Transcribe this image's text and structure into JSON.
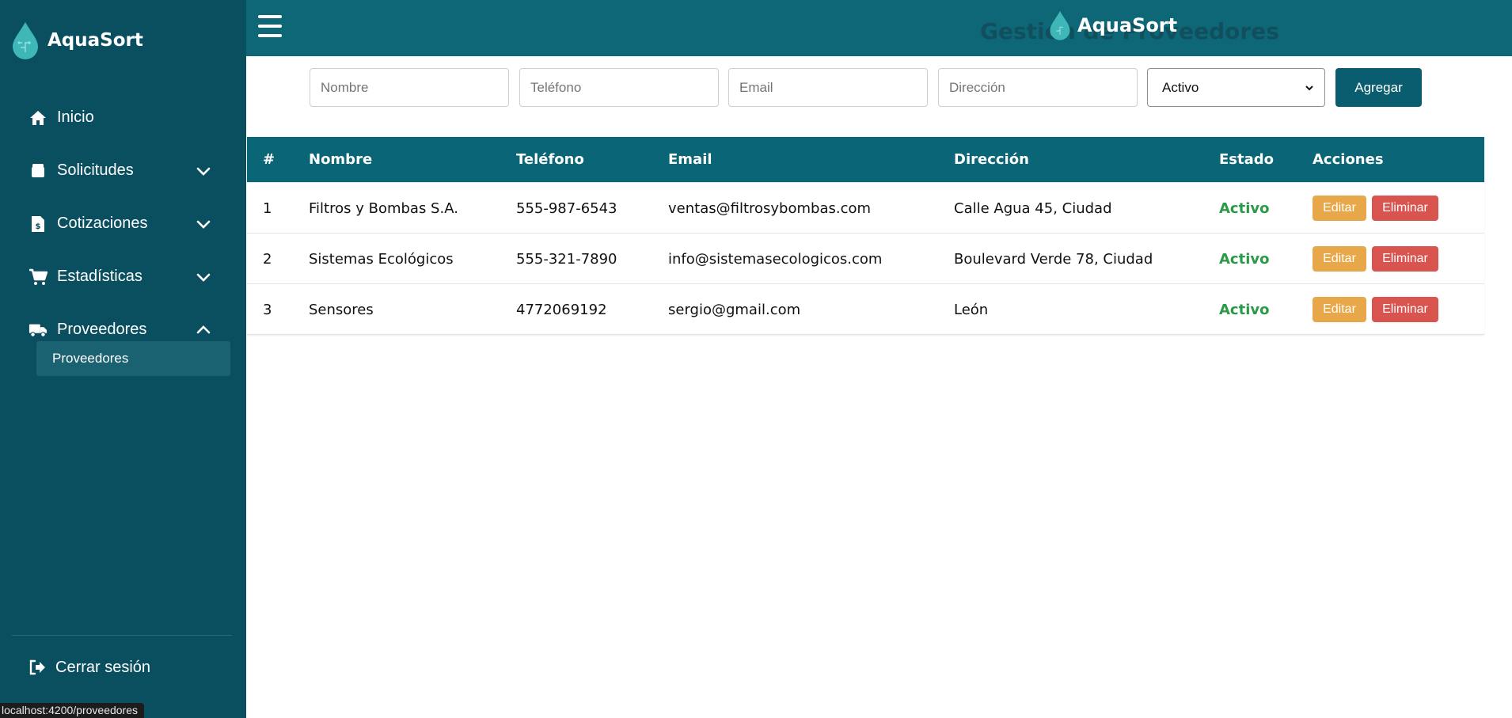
{
  "app": {
    "name": "AquaSort",
    "page_title": "Gestión de Proveedores"
  },
  "colors": {
    "sidebar": "#0a4f60",
    "header": "#0d6777",
    "accent": "#0a5d6e",
    "status_active": "#2a9a48",
    "edit": "#e8a849",
    "delete": "#d9534f"
  },
  "sidebar": {
    "items": [
      {
        "label": "Inicio",
        "icon": "home-icon"
      },
      {
        "label": "Solicitudes",
        "icon": "box-icon"
      },
      {
        "label": "Cotizaciones",
        "icon": "invoice-icon"
      },
      {
        "label": "Estadísticas",
        "icon": "cart-icon"
      },
      {
        "label": "Proveedores",
        "icon": "truck-icon"
      }
    ],
    "subitem": "Proveedores",
    "logout": "Cerrar sesión"
  },
  "status_bar": {
    "url": "localhost:4200/proveedores"
  },
  "form": {
    "nombre_placeholder": "Nombre",
    "telefono_placeholder": "Teléfono",
    "email_placeholder": "Email",
    "direccion_placeholder": "Dirección",
    "estado_value": "Activo",
    "add_label": "Agregar"
  },
  "table": {
    "headers": [
      "#",
      "Nombre",
      "Teléfono",
      "Email",
      "Dirección",
      "Estado",
      "Acciones"
    ],
    "rows": [
      {
        "id": "1",
        "nombre": "Filtros y Bombas S.A.",
        "telefono": "555-987-6543",
        "email": "ventas@filtrosybombas.com",
        "direccion": "Calle Agua 45, Ciudad",
        "estado": "Activo"
      },
      {
        "id": "2",
        "nombre": "Sistemas Ecológicos",
        "telefono": "555-321-7890",
        "email": "info@sistemasecologicos.com",
        "direccion": "Boulevard Verde 78, Ciudad",
        "estado": "Activo"
      },
      {
        "id": "3",
        "nombre": "Sensores",
        "telefono": "4772069192",
        "email": "sergio@gmail.com",
        "direccion": "León",
        "estado": "Activo"
      }
    ],
    "edit_label": "Editar",
    "delete_label": "Eliminar"
  }
}
